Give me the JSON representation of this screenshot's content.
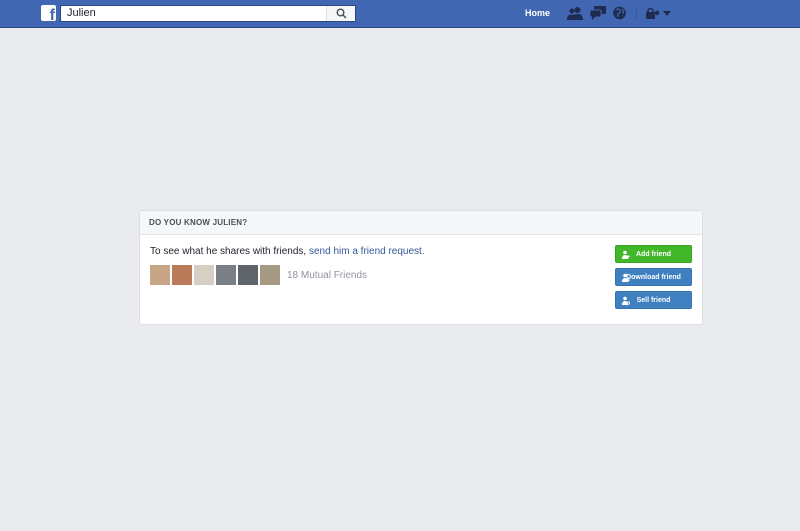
{
  "topbar": {
    "logo_letter": "f",
    "search_value": "Julien",
    "home_label": "Home",
    "icons": [
      "friend-requests-icon",
      "messages-icon",
      "notifications-globe-icon",
      "account-lock-icon",
      "chevron-down-icon"
    ]
  },
  "card": {
    "header": "DO YOU KNOW JULIEN?",
    "message_prefix": "To see what he shares with friends, ",
    "message_link": "send him a friend request.",
    "mutual_friends": "18 Mutual Friends",
    "photos": [
      "#c9a588",
      "#b97b5a",
      "#d8cfc4",
      "#7a7f86",
      "#5e6469",
      "#a79a82"
    ],
    "buttons": {
      "add": "Add friend",
      "download": "Download friend",
      "sell": "Sell friend"
    }
  },
  "colors": {
    "brand": "#4267b2",
    "background": "#e9ebee",
    "add_green": "#42b72a",
    "action_blue": "#4080c0",
    "link": "#365899"
  }
}
